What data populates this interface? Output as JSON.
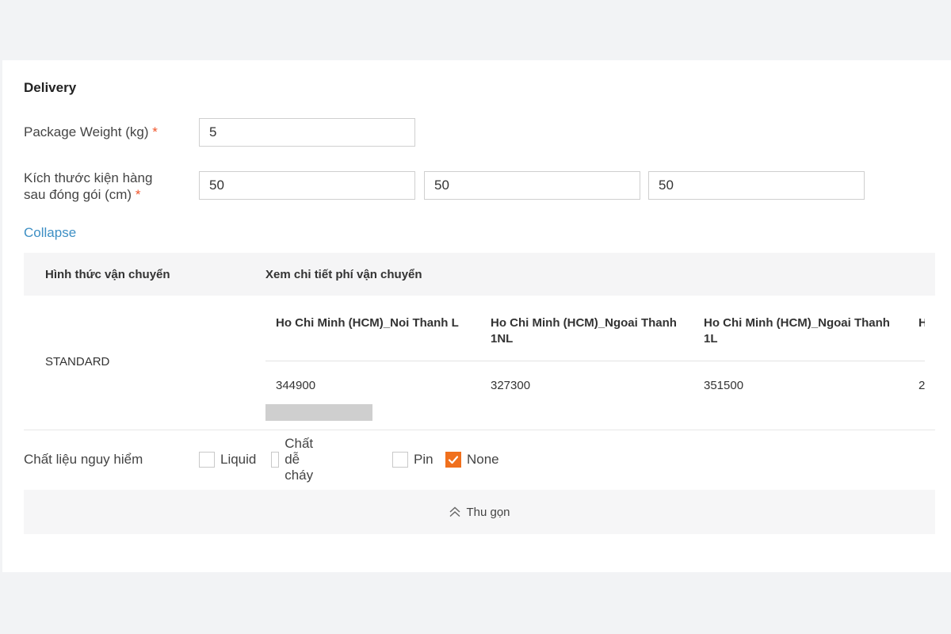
{
  "delivery": {
    "title": "Delivery",
    "weight": {
      "label": "Package Weight (kg)",
      "required": "*",
      "value": "5"
    },
    "dimensions": {
      "label_line1": "Kích thước kiện hàng",
      "label_line2": "sau đóng gói (cm)",
      "required": "*",
      "length": "50",
      "width": "50",
      "height": "50"
    },
    "collapse_link": "Collapse"
  },
  "shipping_table": {
    "headers": {
      "method": "Hình thức vận chuyển",
      "details": "Xem chi tiết phí vận chuyển"
    },
    "method": "STANDARD",
    "zones": [
      {
        "name": "Ho Chi Minh (HCM)_Noi Thanh L",
        "price": "344900"
      },
      {
        "name": "Ho Chi Minh (HCM)_Ngoai Thanh 1NL",
        "price": "327300"
      },
      {
        "name": "Ho Chi Minh (HCM)_Ngoai Thanh 1L",
        "price": "351500"
      },
      {
        "name": "H",
        "price": "2"
      }
    ]
  },
  "dangerous_goods": {
    "label": "Chất liệu nguy hiểm",
    "options": [
      {
        "label": "Liquid",
        "checked": false
      },
      {
        "label": "Chất dễ cháy",
        "checked": false
      },
      {
        "label": "Pin",
        "checked": false
      },
      {
        "label": "None",
        "checked": true
      }
    ]
  },
  "collapse_bar": {
    "label": "Thu gọn",
    "icon": "double-chevron-up-icon"
  },
  "colors": {
    "accent": "#f0701d",
    "link": "#3d8fc4",
    "required": "#f0552b"
  }
}
